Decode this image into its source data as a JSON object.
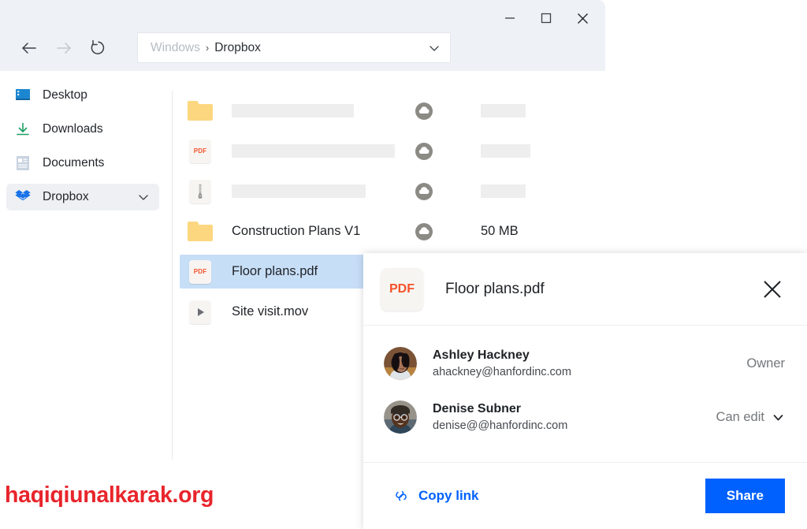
{
  "window": {
    "controls": {
      "minimize": "minimize-icon",
      "maximize": "maximize-icon",
      "close": "close-icon"
    },
    "nav": {
      "back": "back-arrow-icon",
      "forward": "forward-arrow-icon",
      "refresh": "refresh-icon"
    },
    "address": {
      "root": "Windows",
      "separator": "›",
      "current": "Dropbox",
      "chevron": "chevron-down-icon"
    }
  },
  "sidebar": {
    "items": [
      {
        "label": "Desktop",
        "icon": "desktop-icon",
        "selected": false,
        "chevron": false
      },
      {
        "label": "Downloads",
        "icon": "download-icon",
        "selected": false,
        "chevron": false
      },
      {
        "label": "Documents",
        "icon": "document-icon",
        "selected": false,
        "chevron": false
      },
      {
        "label": "Dropbox",
        "icon": "dropbox-icon",
        "selected": true,
        "chevron": true
      }
    ]
  },
  "file_list": {
    "rows": [
      {
        "type": "folder",
        "icon": "folder-icon",
        "name": "",
        "placeholder": true,
        "name_width": 155,
        "sync": "cloud-sync-icon",
        "size": "",
        "size_placeholder": true,
        "size_width": 57,
        "selected": false
      },
      {
        "type": "pdf",
        "icon": "pdf-file-icon",
        "name": "",
        "placeholder": true,
        "name_width": 207,
        "sync": "cloud-sync-icon",
        "size": "",
        "size_placeholder": true,
        "size_width": 63,
        "selected": false
      },
      {
        "type": "zip",
        "icon": "zip-file-icon",
        "name": "",
        "placeholder": true,
        "name_width": 170,
        "sync": "cloud-sync-icon",
        "size": "",
        "size_placeholder": true,
        "size_width": 57,
        "selected": false
      },
      {
        "type": "folder",
        "icon": "folder-icon",
        "name": "Construction Plans V1",
        "placeholder": false,
        "sync": "cloud-sync-icon",
        "size": "50 MB",
        "size_placeholder": false,
        "selected": false
      },
      {
        "type": "pdf",
        "icon": "pdf-file-icon",
        "name": "Floor plans.pdf",
        "placeholder": false,
        "sync": "",
        "size": "",
        "size_placeholder": false,
        "selected": true
      },
      {
        "type": "mov",
        "icon": "video-file-icon",
        "name": "Site visit.mov",
        "placeholder": false,
        "sync": "",
        "size": "",
        "size_placeholder": false,
        "selected": false
      }
    ],
    "pdf_badge": "PDF"
  },
  "share_panel": {
    "file_badge": "PDF",
    "file_name": "Floor plans.pdf",
    "close_icon": "close-icon",
    "members": [
      {
        "name": "Ashley Hackney",
        "email": "ahackney@hanfordinc.com",
        "role": "Owner",
        "role_has_chevron": false,
        "avatar": "avatar-ashley"
      },
      {
        "name": "Denise Subner",
        "email": "denise@@hanfordinc.com",
        "role": "Can edit",
        "role_has_chevron": true,
        "avatar": "avatar-denise"
      }
    ],
    "copy_link_label": "Copy link",
    "copy_link_icon": "link-icon",
    "share_label": "Share"
  },
  "watermark": {
    "text": "haqiqiunalkarak.org",
    "color": "#e8252c"
  },
  "colors": {
    "accent_blue": "#0061fe",
    "chrome_bg": "#eef1f6",
    "selection_blue": "#c7def7",
    "folder_yellow": "#fcd77f",
    "pdf_orange": "#f4522a",
    "sync_gray": "#8b8a85"
  }
}
